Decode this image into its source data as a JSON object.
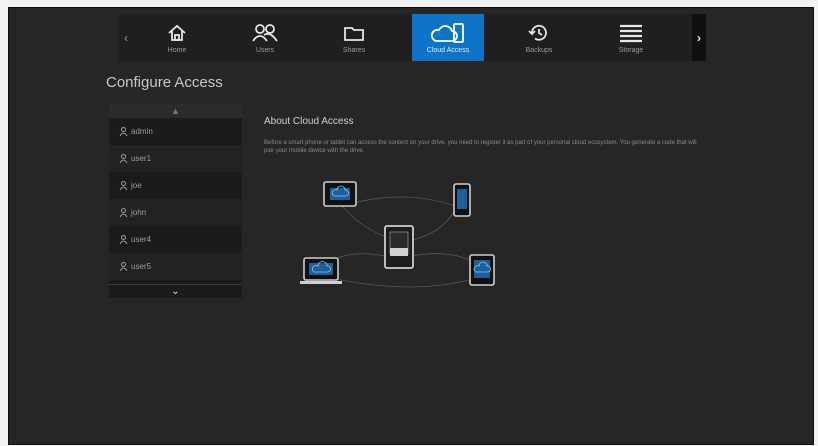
{
  "nav": {
    "items": [
      {
        "label": "Home",
        "icon": "home-icon"
      },
      {
        "label": "Users",
        "icon": "users-icon"
      },
      {
        "label": "Shares",
        "icon": "shares-icon"
      },
      {
        "label": "Cloud Access",
        "icon": "cloud-access-icon",
        "active": true
      },
      {
        "label": "Backups",
        "icon": "backups-icon"
      },
      {
        "label": "Storage",
        "icon": "storage-icon"
      }
    ],
    "left_arrow": "‹",
    "right_arrow": "›"
  },
  "page": {
    "title": "Configure Access"
  },
  "user_list": {
    "scroll_up": "▲",
    "scroll_down": "⌄",
    "users": [
      "admin",
      "user1",
      "joe",
      "john",
      "user4",
      "user5"
    ]
  },
  "about": {
    "title": "About Cloud Access",
    "description": "Before a smart phone or tablet can access the content on your drive, you need to register it as part of your personal cloud ecosystem. You generate a code that will pair your mobile device with the drive."
  },
  "colors": {
    "accent": "#0e74c8",
    "background": "#262626",
    "device_cloud": "#3e8fd6"
  }
}
